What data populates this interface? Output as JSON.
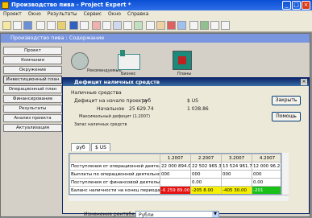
{
  "window": {
    "title": "Производство пива - Project Expert *"
  },
  "menu": [
    {
      "label": "Проект"
    },
    {
      "label": "Окно"
    },
    {
      "label": "Результаты"
    },
    {
      "label": "Сервис"
    },
    {
      "label": "Окно"
    },
    {
      "label": "Справка"
    }
  ],
  "subwindow": {
    "title": "Производство пива : Содержание"
  },
  "nav": [
    {
      "label": "Проект"
    },
    {
      "label": "Компания"
    },
    {
      "label": "Окружение"
    },
    {
      "label": "Инвестиционный план"
    },
    {
      "label": "Операционный план"
    },
    {
      "label": "Финансирование"
    },
    {
      "label": "Результаты"
    },
    {
      "label": "Анализ проекта"
    },
    {
      "label": "Актуализация"
    }
  ],
  "icons": [
    {
      "label": "Рекомендуемые"
    },
    {
      "label": "Бизнес"
    },
    {
      "label": "Планы"
    }
  ],
  "dialog": {
    "title": "Дефицит наличных средств",
    "close_button": "Закрыть",
    "help_button": "Помощь",
    "info_header": "Наличные средства",
    "info_rows": [
      {
        "label": "Дефицит на начало проекта",
        "v1": "руб",
        "v2": "$ US"
      },
      {
        "label": "Начальное",
        "v1": "25 629.74",
        "v2": "1 038.86"
      },
      {
        "label": "Максимальный дефицит (1.2007)",
        "v1": "",
        "v2": ""
      },
      {
        "label": "Запас наличных средств",
        "v1": "",
        "v2": ""
      }
    ],
    "tabs": [
      {
        "label": "руб"
      },
      {
        "label": "$ US"
      }
    ],
    "table": {
      "headers": [
        "",
        "1.2007",
        "2.2007",
        "3.2007",
        "4.2007"
      ],
      "rows": [
        {
          "cells": [
            "Поступления от операционной деятельности",
            "22 000 894.0",
            "22 502 965.3",
            "13 524 961.73",
            "12 000 96.2"
          ],
          "styles": [
            "",
            "",
            "",
            "",
            ""
          ]
        },
        {
          "cells": [
            "Выплаты по операционной деятельности",
            "000",
            "000",
            "000",
            "000"
          ],
          "styles": [
            "",
            "",
            "",
            "",
            ""
          ]
        },
        {
          "cells": [
            "Поступления от финансовой деятельности",
            "",
            "0.00",
            "",
            "0.00"
          ],
          "styles": [
            "",
            "",
            "",
            "",
            ""
          ]
        },
        {
          "cells": [
            "Баланс наличности на конец периода",
            "-6 259 89.00",
            "-205 8.00",
            "-405 30.00",
            "-201"
          ],
          "styles": [
            "",
            "red",
            "yel",
            "yel",
            "grn"
          ]
        }
      ]
    },
    "currency_label": "Изменение рентабельности",
    "currency_value": "Рубли"
  }
}
